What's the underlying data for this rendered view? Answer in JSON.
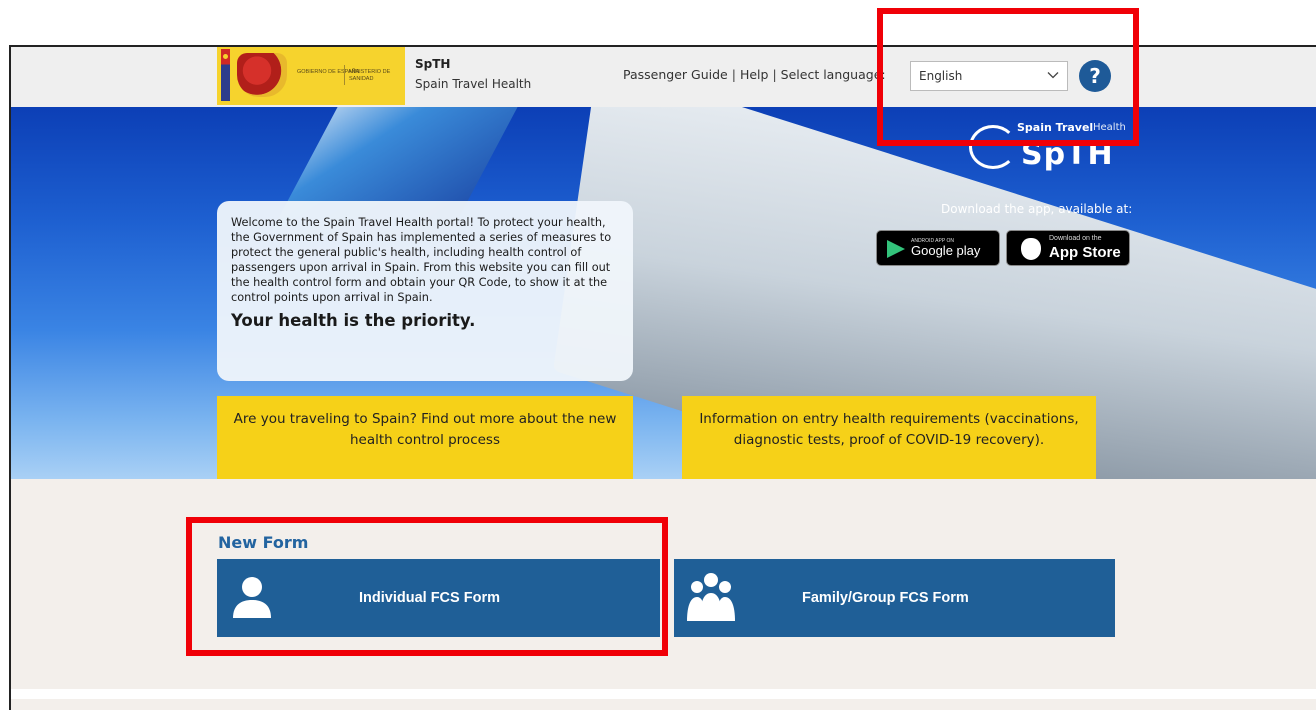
{
  "header": {
    "logo_text_1": "GOBIERNO DE ESPAÑA",
    "logo_text_2": "MINISTERIO DE SANIDAD",
    "site_name": "SpTH",
    "site_subtitle": "Spain Travel Health",
    "nav": {
      "passenger_guide": "Passenger Guide",
      "help": "Help",
      "select_language": "Select language:"
    },
    "language": {
      "selected": "English",
      "options": [
        "English"
      ]
    },
    "help_icon_label": "?"
  },
  "hero": {
    "logo": {
      "word1": "Spain Travel",
      "word2": "Health",
      "big": "SpTH"
    },
    "app_caption": "Download the app, available at:",
    "google_play": {
      "small": "ANDROID APP ON",
      "label": "Google play"
    },
    "app_store": {
      "small": "Download on the",
      "label": "App Store"
    },
    "welcome": {
      "body": "Welcome to the Spain Travel Health portal! To protect your health, the Government of Spain has implemented a series of measures to protect the general public's health, including health control of passengers upon arrival in Spain. From this website you can fill out the health control form and obtain your QR Code, to show it at the control points upon arrival in Spain.",
      "headline": "Your health is the priority."
    },
    "cta_traveling": "Are you traveling to Spain? Find out more about the new health control process",
    "cta_requirements": "Information on entry health requirements (vaccinations, diagnostic tests, proof of COVID-19 recovery)."
  },
  "forms": {
    "title": "New Form",
    "individual": "Individual FCS Form",
    "group": "Family/Group FCS Form"
  },
  "colors": {
    "header_bg": "#efefef",
    "accent_blue": "#1f5f97",
    "cta_yellow": "#f6d118",
    "highlight_red": "#f00007"
  }
}
